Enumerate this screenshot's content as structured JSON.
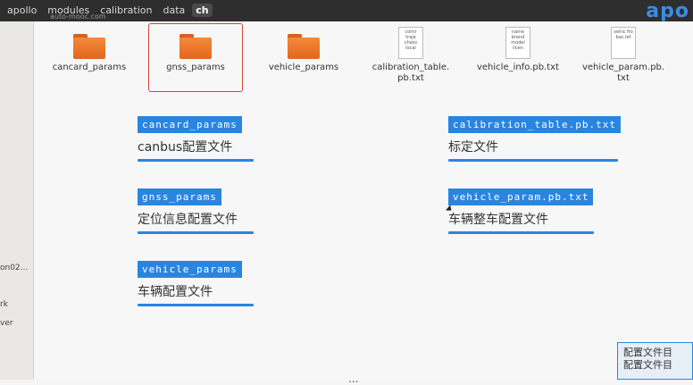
{
  "topbar": {
    "breadcrumbs": [
      "apollo",
      "modules",
      "calibration",
      "data",
      "ch"
    ],
    "brand": "apo",
    "watermark": "auto-mooc.com"
  },
  "sidebar": {
    "items": [
      "on02...",
      "rk",
      "ver"
    ]
  },
  "files": [
    {
      "name": "cancard_params",
      "kind": "folder",
      "selected": false
    },
    {
      "name": "gnss_params",
      "kind": "folder",
      "selected": true
    },
    {
      "name": "vehicle_params",
      "kind": "folder",
      "selected": false
    },
    {
      "name": "calibration_table.\npb.txt",
      "kind": "text",
      "preview": "contr traje chass local"
    },
    {
      "name": "vehicle_info.pb.txt",
      "kind": "text",
      "preview": "name brand model licen"
    },
    {
      "name": "vehicle_param.pb.\ntxt",
      "kind": "text",
      "preview": "vehic fro bac lef"
    }
  ],
  "annotations": [
    {
      "header": "cancard_params",
      "desc": "canbus配置文件"
    },
    {
      "header": "gnss_params",
      "desc": "定位信息配置文件"
    },
    {
      "header": "vehicle_params",
      "desc": "车辆配置文件"
    },
    {
      "header": "calibration_table.pb.txt",
      "desc": "标定文件"
    },
    {
      "header": "vehicle_param.pb.txt",
      "desc": "车辆整车配置文件"
    }
  ],
  "corner_box": {
    "line1": "配置文件目",
    "line2": "配置文件目"
  },
  "bottom_text": "...",
  "colors": {
    "accent": "#2a85e0",
    "selection": "#d9443a",
    "folder": "#e2671f"
  }
}
